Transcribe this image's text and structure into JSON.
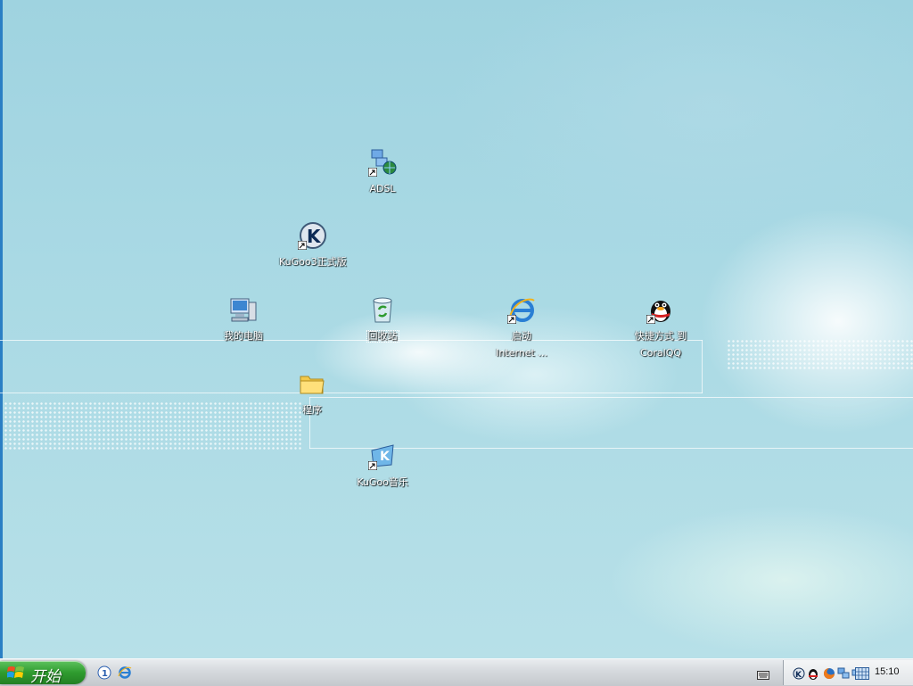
{
  "desktop": {
    "icons": [
      {
        "id": "adsl",
        "label": "ADSL",
        "icon": "network-connection-icon",
        "shortcut": true,
        "selected": false
      },
      {
        "id": "kugoo3",
        "label": "KuGoo3正式版",
        "icon": "kugoo-icon",
        "shortcut": true,
        "selected": false
      },
      {
        "id": "my-computer",
        "label": "我的电脑",
        "icon": "computer-icon",
        "shortcut": false,
        "selected": false
      },
      {
        "id": "recycle-bin",
        "label": "回收站",
        "icon": "recycle-bin-icon",
        "shortcut": false,
        "selected": true
      },
      {
        "id": "internet",
        "label": "启动",
        "label2": "Internet ...",
        "icon": "internet-explorer-icon",
        "shortcut": true,
        "selected": false
      },
      {
        "id": "qq",
        "label": "快捷方式 到",
        "label2": "CoralQQ",
        "icon": "qq-penguin-icon",
        "shortcut": true,
        "selected": false
      },
      {
        "id": "programs",
        "label": "程序",
        "icon": "folder-icon",
        "shortcut": false,
        "selected": false
      },
      {
        "id": "kugoo-music",
        "label": "KuGoo音乐",
        "icon": "kugoo-music-icon",
        "shortcut": true,
        "selected": false
      }
    ]
  },
  "taskbar": {
    "start_label": "开始",
    "quick_launch": [
      "info-icon",
      "internet-explorer-icon"
    ],
    "tray_icons": [
      "kugoo-icon",
      "qq-penguin-icon",
      "firefox-icon",
      "network-icon",
      "adsl-icon",
      "keyboard-grid-icon"
    ],
    "clock": "15:10",
    "colors": {
      "start_green": "#2f9b2f",
      "desktop_blue": "#a9d9e4"
    }
  }
}
